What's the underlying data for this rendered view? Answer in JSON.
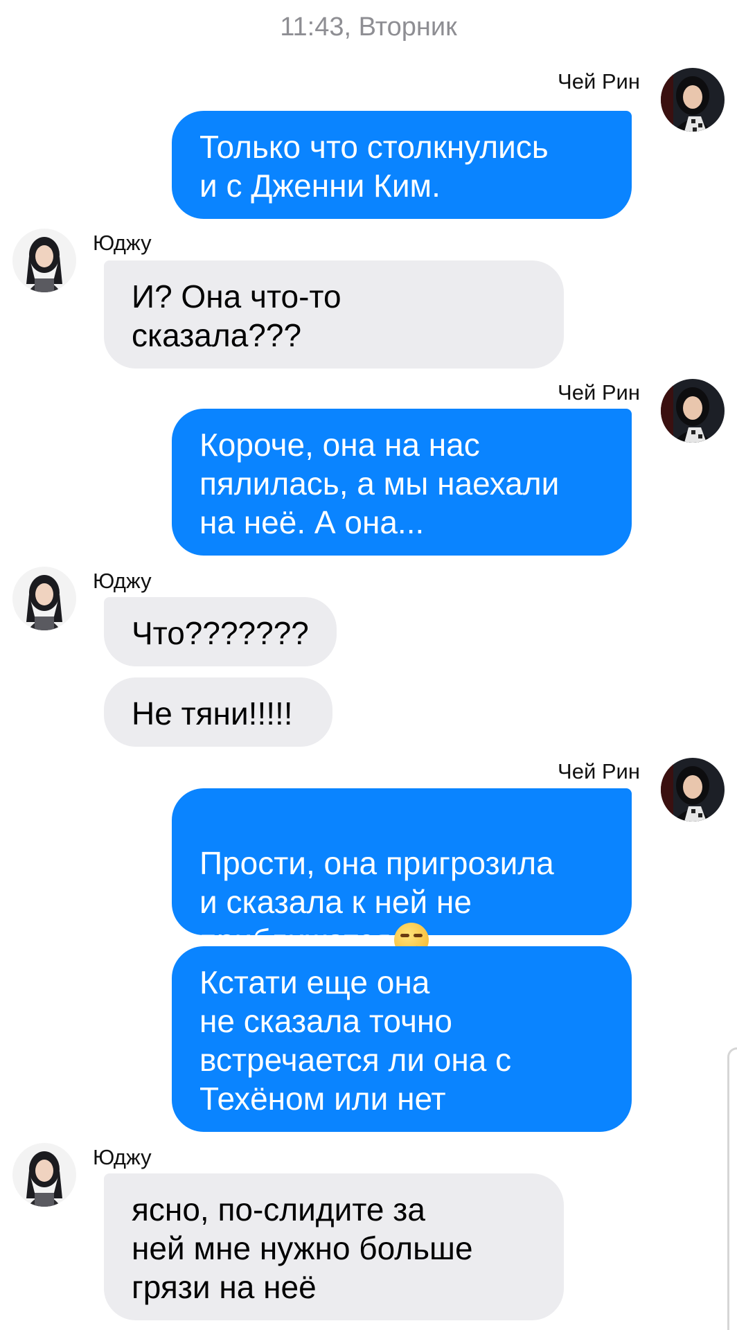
{
  "header": {
    "timestamp": "11:43, Вторник"
  },
  "participants": {
    "me": {
      "name": "Чей Рин",
      "avatar_icon": "avatar-chae-rin"
    },
    "other": {
      "name": "Юджу",
      "avatar_icon": "avatar-yuju"
    }
  },
  "messages": [
    {
      "sender": "Чей Рин",
      "text": "Только что столкнулись\nи с Дженни Ким."
    },
    {
      "sender": "Юджу",
      "text": "И? Она что-то\nсказала???"
    },
    {
      "sender": "Чей Рин",
      "text": "Короче, она на нас\nпялилась, а мы наехали\nна неё. А она..."
    },
    {
      "sender": "Юджу",
      "text": "Что???????"
    },
    {
      "sender": "Юджу",
      "text": "Не тяни!!!!!"
    },
    {
      "sender": "Чей Рин",
      "text": "Прости, она пригрозила\nи сказала к ней не\nприближатся",
      "emoji": "unamused-face-icon"
    },
    {
      "sender": "Чей Рин",
      "text": "Кстати еще она\nне сказала точно\nвстречается ли она с\nТехёном или нет"
    },
    {
      "sender": "Юджу",
      "text": "ясно, по-слидите за\nней мне нужно больше\nгрязи на неё"
    }
  ],
  "colors": {
    "outgoing": "#0a84ff",
    "incoming": "#ececef",
    "timestamp": "#8e8e93"
  }
}
